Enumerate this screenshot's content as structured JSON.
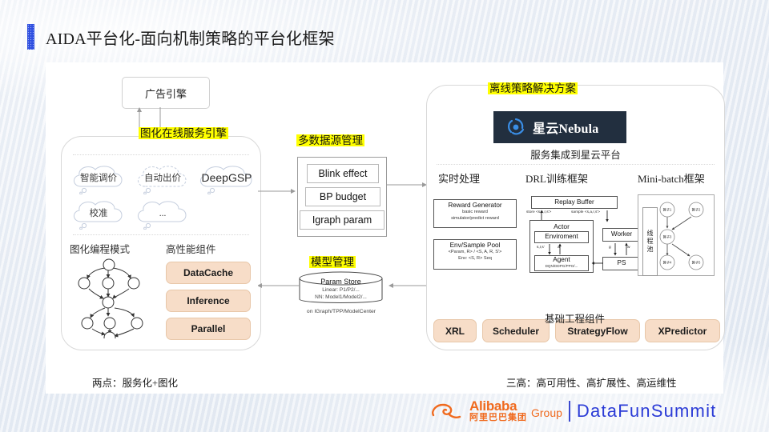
{
  "slide": {
    "title": "AIDA平台化-面向机制策略的平台化框架"
  },
  "top": {
    "ad_engine": "广告引擎"
  },
  "left_panel": {
    "title": "图化在线服务引擎",
    "clouds": [
      "智能调价",
      "自动出价",
      "DeepGSP",
      "校准",
      "..."
    ],
    "section_graph_mode": "图化编程模式",
    "section_components": "高性能组件",
    "components": [
      "DataCache",
      "Inference",
      "Parallel"
    ],
    "caption": "两点：服务化+图化"
  },
  "middle": {
    "datasource_title": "多数据源管理",
    "datasource_items": [
      "Blink effect",
      "BP budget",
      "Igraph param"
    ],
    "model_title": "模型管理",
    "param_store": {
      "name": "Param Store",
      "line1": "Linear: P1/P2/...",
      "line2": "NN: Model1/Model2/...",
      "footnote": "on IGraph/TPP/ModelCenter"
    }
  },
  "right_panel": {
    "title": "离线策略解决方案",
    "logo_text": "星云Nebula",
    "logo_caption": "服务集成到星云平台",
    "columns": [
      "实时处理",
      "DRL训练框架",
      "Mini-batch框架"
    ],
    "realtime": [
      {
        "name": "Reward Generator",
        "line1": "basic reward",
        "line2": "simulator/predict reward"
      },
      {
        "name": "Env/Sample Pool",
        "line1": "<Param, R> / <S, A, R, S'>",
        "line2": "Env: <S, R> Seq"
      }
    ],
    "drl": {
      "replay_buffer": "Replay Buffer",
      "store_label": "store <s,a,r,s'>",
      "sample_label": "sample <s,a,r,s'>",
      "actor": "Actor",
      "environment": "Enviroment",
      "agent": "Agent",
      "agent_sub": "DQN/DDPG/PPO/...",
      "worker": "Worker",
      "ps": "PS",
      "edge_sr": "s,r,s'",
      "edge_a": "a",
      "edge_g": "g",
      "edge_w": "w"
    },
    "minibatch": {
      "thread_pool": "线程池",
      "nodes": [
        "算子1",
        "算子2",
        "算子3",
        "算子4",
        "算子5"
      ]
    },
    "base_components_title": "基础工程组件",
    "base_components": [
      "XRL",
      "Scheduler",
      "StrategyFlow",
      "XPredictor"
    ],
    "caption": "三高：高可用性、高扩展性、高运维性"
  },
  "footer": {
    "alibaba_en": "Alibaba",
    "alibaba_group": "Group",
    "alibaba_cn": "阿里巴巴集团",
    "summit": "DataFunSummit"
  },
  "colors": {
    "accent_blue": "#2f4fe0",
    "highlight": "#ffff00",
    "pill": "#f7ddc8",
    "nebula_bg": "#222f3f",
    "alibaba_orange": "#f06a1e",
    "summit_blue": "#2b3bd6"
  }
}
